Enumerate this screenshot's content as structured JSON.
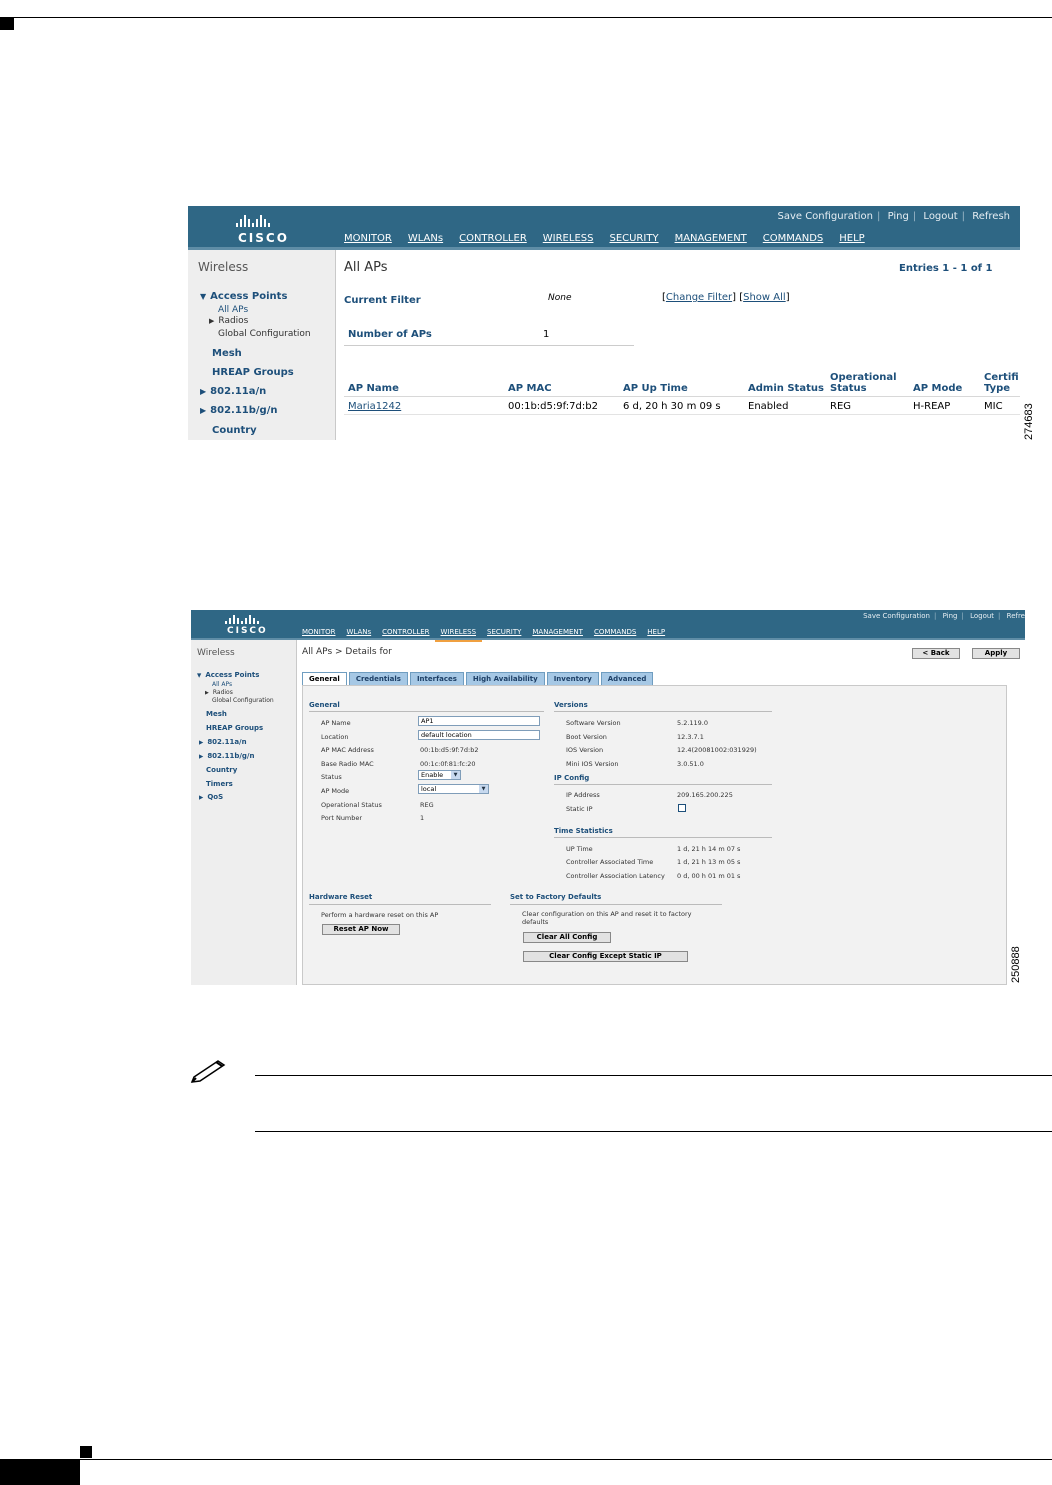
{
  "figure1": {
    "top_links": [
      "Save Configuration",
      "Ping",
      "Logout",
      "Refresh"
    ],
    "menu": [
      "MONITOR",
      "WLANs",
      "CONTROLLER",
      "WIRELESS",
      "SECURITY",
      "MANAGEMENT",
      "COMMANDS",
      "HELP"
    ],
    "logo": "CISCO",
    "sidebar": {
      "title": "Wireless",
      "access_points": "Access Points",
      "all_aps": "All APs",
      "radios": "Radios",
      "global_config": "Global Configuration",
      "mesh": "Mesh",
      "hreap": "HREAP Groups",
      "a_n": "802.11a/n",
      "bgn": "802.11b/g/n",
      "country": "Country"
    },
    "page_title": "All APs",
    "entries": "Entries 1 - 1 of 1",
    "current_filter_label": "Current Filter",
    "current_filter_value": "None",
    "change_filter": "Change Filter",
    "show_all": "Show All",
    "number_label": "Number of APs",
    "number_value": "1",
    "table": {
      "headers": [
        "AP Name",
        "AP MAC",
        "AP Up Time",
        "Admin Status",
        "Operational Status",
        "AP Mode",
        "Certifi Type"
      ],
      "row": [
        "Maria1242",
        "00:1b:d5:9f:7d:b2",
        "6 d, 20 h 30 m 09 s",
        "Enabled",
        "REG",
        "H-REAP",
        "MIC"
      ]
    },
    "figure_id": "274683"
  },
  "figure2": {
    "top_links": [
      "Save Configuration",
      "Ping",
      "Logout",
      "Refre"
    ],
    "menu": [
      "MONITOR",
      "WLANs",
      "CONTROLLER",
      "WIRELESS",
      "SECURITY",
      "MANAGEMENT",
      "COMMANDS",
      "HELP"
    ],
    "logo": "CISCO",
    "sidebar": {
      "title": "Wireless",
      "access_points": "Access Points",
      "all_aps": "All APs",
      "radios": "Radios",
      "global_config": "Global Configuration",
      "mesh": "Mesh",
      "hreap": "HREAP Groups",
      "a_n": "802.11a/n",
      "bgn": "802.11b/g/n",
      "country": "Country",
      "timers": "Timers",
      "qos": "QoS"
    },
    "breadcrumb": "All APs > Details for",
    "back_button": "< Back",
    "apply_button": "Apply",
    "tabs": [
      "General",
      "Credentials",
      "Interfaces",
      "High Availability",
      "Inventory",
      "Advanced"
    ],
    "general": {
      "heading": "General",
      "ap_name_label": "AP Name",
      "ap_name_value": "AP1",
      "location_label": "Location",
      "location_value": "default location",
      "mac_label": "AP MAC Address",
      "mac_value": "00:1b:d5:9f:7d:b2",
      "radio_mac_label": "Base Radio MAC",
      "radio_mac_value": "00:1c:0f:81:fc:20",
      "status_label": "Status",
      "status_value": "Enable",
      "mode_label": "AP Mode",
      "mode_value": "local",
      "op_label": "Operational Status",
      "op_value": "REG",
      "port_label": "Port Number",
      "port_value": "1"
    },
    "versions": {
      "heading": "Versions",
      "sw_label": "Software Version",
      "sw_value": "5.2.119.0",
      "boot_label": "Boot Version",
      "boot_value": "12.3.7.1",
      "ios_label": "IOS Version",
      "ios_value": "12.4(20081002:031929)",
      "mini_label": "Mini IOS Version",
      "mini_value": "3.0.51.0"
    },
    "ip_config": {
      "heading": "IP Config",
      "ip_label": "IP Address",
      "ip_value": "209.165.200.225",
      "static_label": "Static IP"
    },
    "time_stats": {
      "heading": "Time Statistics",
      "up_label": "UP Time",
      "up_value": "1 d, 21 h 14 m 07 s",
      "assoc_label": "Controller Associated Time",
      "assoc_value": "1 d, 21 h 13 m 05 s",
      "latency_label": "Controller Association Latency",
      "latency_value": "0 d, 00 h 01 m 01 s"
    },
    "hardware_reset": {
      "heading": "Hardware Reset",
      "text": "Perform a hardware reset on this AP",
      "button": "Reset AP Now"
    },
    "factory": {
      "heading": "Set to Factory Defaults",
      "text1": "Clear configuration on this AP and reset it to factory",
      "text2": "defaults",
      "clear_all": "Clear All Config",
      "clear_except": "Clear Config Except Static IP"
    },
    "figure_id": "250888"
  }
}
